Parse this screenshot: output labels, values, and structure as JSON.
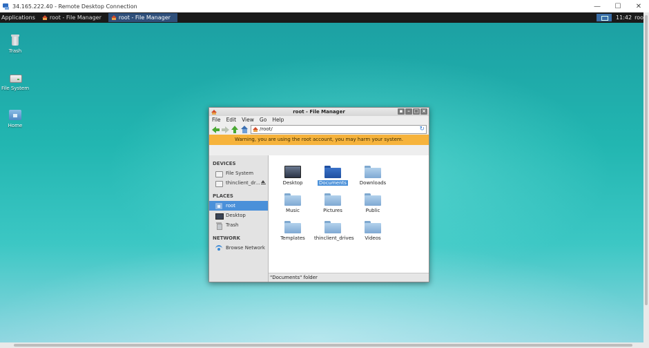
{
  "rdp": {
    "title": "34.165.222.40 - Remote Desktop Connection",
    "minimize": "—",
    "maximize": "☐",
    "close": "✕"
  },
  "panel": {
    "applications": "Applications",
    "tasks": [
      {
        "label": "root - File Manager"
      },
      {
        "label": "root - File Manager"
      }
    ],
    "clock": "11:42",
    "user": "roo"
  },
  "desktop_icons": [
    {
      "label": "Trash"
    },
    {
      "label": "File System"
    },
    {
      "label": "Home"
    }
  ],
  "window": {
    "title": "root - File Manager",
    "menu": [
      "File",
      "Edit",
      "View",
      "Go",
      "Help"
    ],
    "address": "/root/",
    "warning": "Warning, you are using the root account, you may harm your system.",
    "sidebar": {
      "devices_heading": "DEVICES",
      "devices": [
        {
          "label": "File System"
        },
        {
          "label": "thinclient_dr..."
        }
      ],
      "places_heading": "PLACES",
      "places": [
        {
          "label": "root"
        },
        {
          "label": "Desktop"
        },
        {
          "label": "Trash"
        }
      ],
      "network_heading": "NETWORK",
      "network": [
        {
          "label": "Browse Network"
        }
      ]
    },
    "items": [
      {
        "label": "Desktop"
      },
      {
        "label": "Documents"
      },
      {
        "label": "Downloads"
      },
      {
        "label": "Music"
      },
      {
        "label": "Pictures"
      },
      {
        "label": "Public"
      },
      {
        "label": "Templates"
      },
      {
        "label": "thinclient_drives"
      },
      {
        "label": "Videos"
      }
    ],
    "status": "\"Documents\" folder"
  },
  "colors": {
    "accent": "#4a90d9",
    "warning_bg": "#f6b33c",
    "panel_bg": "#1a1a1a",
    "desktop_teal": "#22b6b1"
  }
}
